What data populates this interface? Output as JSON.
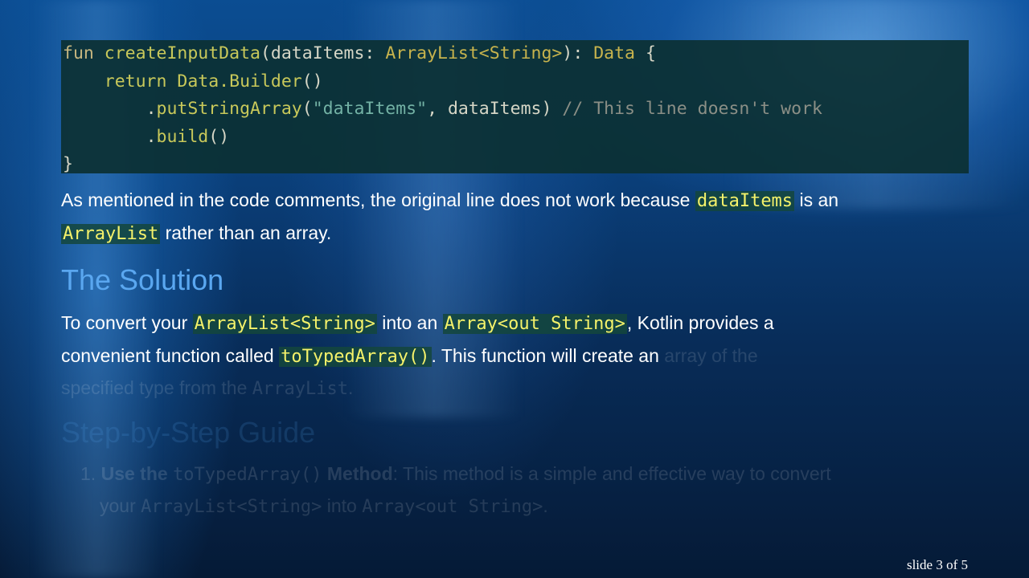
{
  "code": {
    "l1_kw": "fun",
    "l1_fn": "createInputData",
    "l1_open": "(",
    "l1_param": "dataItems",
    "l1_colon": ": ",
    "l1_type": "ArrayList<String>",
    "l1_close": "): ",
    "l1_ret": "Data",
    "l1_brace": " {",
    "l2_kw": "return",
    "l2_call": "Data.Builder",
    "l2_paren": "()",
    "l3_dot": ".",
    "l3_fn": "putStringArray",
    "l3_open": "(",
    "l3_str": "\"dataItems\"",
    "l3_args": ", dataItems) ",
    "l3_comment": "// This line doesn't work",
    "l4_dot": ".",
    "l4_fn": "build",
    "l4_paren": "()",
    "l5_brace": "}"
  },
  "para1": {
    "t1": "As mentioned in the code comments, the original line does not work because ",
    "c1": "dataItems",
    "t2": " is an",
    "c2": "ArrayList",
    "t3": " rather than an array."
  },
  "solution_heading": "The Solution",
  "para2": {
    "t1": "To convert your ",
    "c1": "ArrayList<String>",
    "t2": " into an ",
    "c2": "Array<out String>",
    "t3": ", Kotlin provides a",
    "t4": "convenient function called ",
    "c3": "toTypedArray()",
    "t5": ". This function will create an ",
    "f1": "array of the",
    "f2": "specified type from the ",
    "f3": "ArrayList",
    "f4": "."
  },
  "guide_heading": "Step-by-Step Guide",
  "guide": {
    "num": "1.",
    "b1": "Use the ",
    "m1": "toTypedArray()",
    "b2": " Method",
    "t1": ": This method is a simple and effective way to convert",
    "t2": "your ",
    "m2": "ArrayList<String>",
    "t3": " into ",
    "m3": "Array<out String>",
    "t4": "."
  },
  "slide_indicator": "slide 3 of 5"
}
